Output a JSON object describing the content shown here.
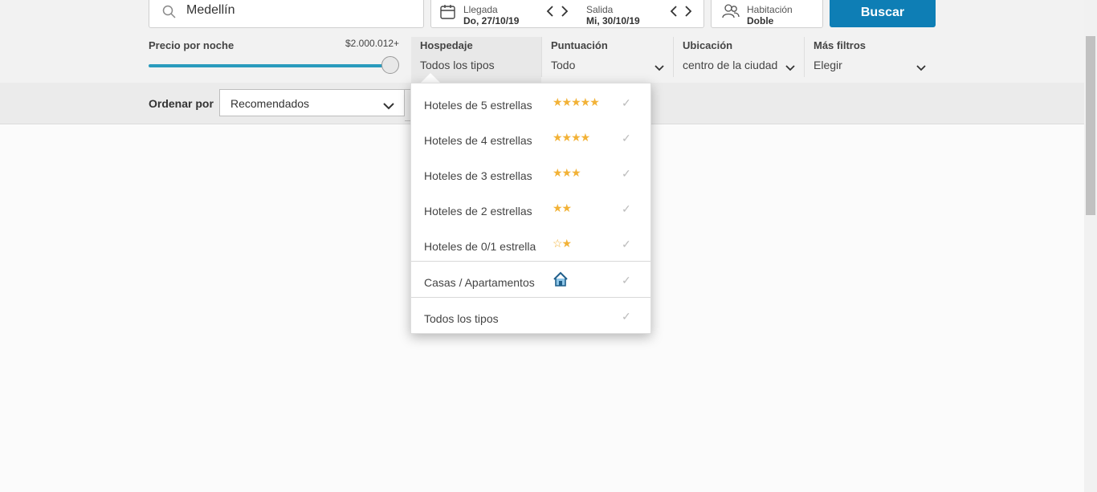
{
  "search": {
    "destination": "Medellín"
  },
  "dates": {
    "checkin_label": "Llegada",
    "checkin_value": "Do, 27/10/19",
    "checkout_label": "Salida",
    "checkout_value": "Mi, 30/10/19"
  },
  "room": {
    "label": "Habitación",
    "value": "Doble"
  },
  "search_button": "Buscar",
  "filters": {
    "price": {
      "label": "Precio por noche",
      "max": "$2.000.012+",
      "level_fraction": 1.0
    },
    "lodging": {
      "label": "Hospedaje",
      "value": "Todos los tipos"
    },
    "rating": {
      "label": "Puntuación",
      "value": "Todo"
    },
    "location": {
      "label": "Ubicación",
      "value": "centro de la ciudad"
    },
    "more": {
      "label": "Más filtros",
      "value": "Elegir"
    }
  },
  "sort": {
    "label": "Ordenar por",
    "value": "Recomendados"
  },
  "lodging_dropdown": {
    "options": [
      {
        "name": "Hoteles de 5 estrellas",
        "stars": "★★★★★"
      },
      {
        "name": "Hoteles de 4 estrellas",
        "stars": "★★★★"
      },
      {
        "name": "Hoteles de 3 estrellas",
        "stars": "★★★"
      },
      {
        "name": "Hoteles de 2 estrellas",
        "stars": "★★"
      },
      {
        "name": "Hoteles de 0/1 estrella",
        "stars": "☆★"
      },
      {
        "name": "Casas / Apartamentos",
        "icon": "house-icon"
      },
      {
        "name": "Todos los tipos"
      }
    ],
    "check_glyph": "✓",
    "star_color": "#f2b237"
  },
  "colors": {
    "accent": "#0e7eb5",
    "slider": "#2a9bbd"
  }
}
